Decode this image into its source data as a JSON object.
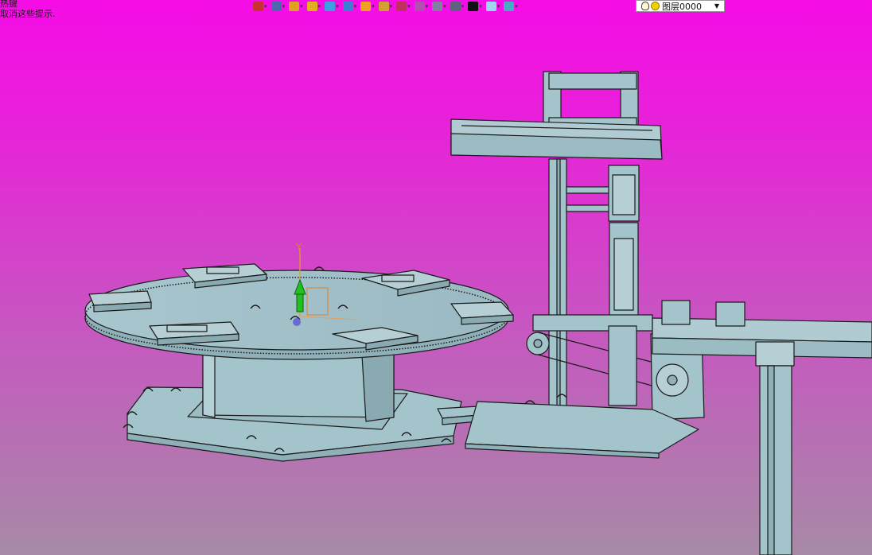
{
  "hint": {
    "line1": "热键",
    "line2": "取消这些提示."
  },
  "toolbar": {
    "buttons": [
      {
        "icon": "select-icon",
        "color": "#c83232"
      },
      {
        "icon": "sketch-icon",
        "color": "#4a6ab0"
      },
      {
        "icon": "pencil-icon",
        "color": "#e0a020"
      },
      {
        "icon": "box-icon",
        "color": "#e0b020"
      },
      {
        "icon": "solid-icon",
        "color": "#3aa0e0"
      },
      {
        "icon": "cube-icon",
        "color": "#3a80d0"
      },
      {
        "icon": "render-icon",
        "color": "#f0a020"
      },
      {
        "icon": "zoom-icon",
        "color": "#d0a030"
      },
      {
        "icon": "move-icon",
        "color": "#c03060"
      },
      {
        "icon": "page-icon",
        "color": "#b050b0"
      },
      {
        "icon": "view-icon",
        "color": "#8080a0"
      },
      {
        "icon": "monitor-icon",
        "color": "#606080"
      },
      {
        "icon": "line-color-icon",
        "color": "#111111"
      },
      {
        "icon": "fill-color-icon",
        "color": "#9ad8f0"
      },
      {
        "icon": "layers-icon",
        "color": "#40b0c0"
      }
    ],
    "layer_label": "图层0000"
  },
  "model": {
    "axis_label": "Y",
    "part_color": "#a4c4cc",
    "edge_color": "#1a1a1a"
  }
}
